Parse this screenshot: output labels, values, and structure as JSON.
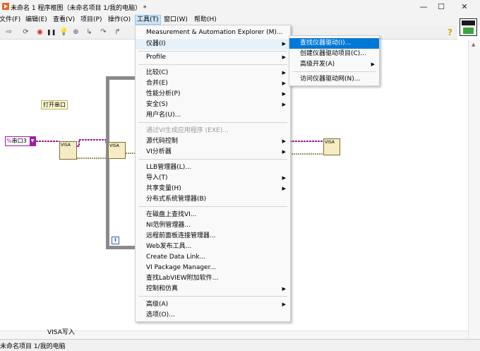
{
  "window": {
    "title": "未命名 1 程序框图（未命名项目 1/我的电脑） *",
    "min_glyph": "—",
    "max_glyph": "☐",
    "close_glyph": "✕"
  },
  "menubar": {
    "items": [
      {
        "label": "文件(F)"
      },
      {
        "label": "编辑(E)"
      },
      {
        "label": "查看(V)"
      },
      {
        "label": "项目(P)"
      },
      {
        "label": "操作(O)"
      },
      {
        "label": "工具(T)"
      },
      {
        "label": "窗口(W)"
      },
      {
        "label": "帮助(H)"
      }
    ]
  },
  "toolbar": {
    "help_glyph": "?",
    "icons": [
      {
        "name": "run-arrow-icon",
        "glyph": "⇨"
      },
      {
        "name": "run-continuous-icon",
        "glyph": "⟳"
      },
      {
        "name": "abort-icon",
        "glyph": "◉"
      },
      {
        "name": "pause-icon",
        "glyph": "❚❚"
      },
      {
        "name": "highlight-execution-icon",
        "glyph": "💡"
      },
      {
        "name": "retain-wire-values-icon",
        "glyph": "⊕"
      },
      {
        "name": "step-into-icon",
        "glyph": "↳"
      },
      {
        "name": "step-over-icon",
        "glyph": "↷"
      },
      {
        "name": "step-out-icon",
        "glyph": "↱"
      }
    ]
  },
  "diagram": {
    "label_open_port": "打开串口",
    "serial_control": "串口3",
    "serial_prefix": "%",
    "visa_caption": "VISA写入",
    "loop_iteration": "i",
    "visa_text": "VISA"
  },
  "tools_menu": {
    "items": [
      {
        "label": "Measurement & Automation Explorer (M)...",
        "submenu": false,
        "disabled": false
      },
      {
        "label": "仪器(I)",
        "submenu": true,
        "disabled": false,
        "highlighted": true
      },
      {
        "label": "Profile",
        "submenu": true,
        "disabled": false
      },
      {
        "label": "比较(C)",
        "submenu": true,
        "disabled": false
      },
      {
        "label": "合并(E)",
        "submenu": true,
        "disabled": false
      },
      {
        "label": "性能分析(P)",
        "submenu": true,
        "disabled": false
      },
      {
        "label": "安全(S)",
        "submenu": true,
        "disabled": false
      },
      {
        "label": "用户名(U)...",
        "submenu": false,
        "disabled": false
      },
      {
        "label": "通过VI生成应用程序 (EXE)...",
        "submenu": false,
        "disabled": true
      },
      {
        "label": "源代码控制",
        "submenu": true,
        "disabled": false
      },
      {
        "label": "VI分析器",
        "submenu": true,
        "disabled": false
      },
      {
        "label": "LLB管理器(L)...",
        "submenu": false,
        "disabled": false
      },
      {
        "label": "导入(T)",
        "submenu": true,
        "disabled": false
      },
      {
        "label": "共享变量(H)",
        "submenu": true,
        "disabled": false
      },
      {
        "label": "分布式系统管理器(B)",
        "submenu": false,
        "disabled": false
      },
      {
        "label": "在磁盘上查找VI...",
        "submenu": false,
        "disabled": false
      },
      {
        "label": "NI范例管理器...",
        "submenu": false,
        "disabled": false
      },
      {
        "label": "远程前面板连接管理器...",
        "submenu": false,
        "disabled": false
      },
      {
        "label": "Web发布工具...",
        "submenu": false,
        "disabled": false
      },
      {
        "label": "Create Data Link...",
        "submenu": false,
        "disabled": false
      },
      {
        "label": "VI Package Manager...",
        "submenu": false,
        "disabled": false
      },
      {
        "label": "查找LabVIEW附加软件...",
        "submenu": false,
        "disabled": false
      },
      {
        "label": "控制和仿真",
        "submenu": true,
        "disabled": false
      },
      {
        "label": "高级(A)",
        "submenu": true,
        "disabled": false
      },
      {
        "label": "选项(O)...",
        "submenu": false,
        "disabled": false
      }
    ]
  },
  "instruments_submenu": {
    "items": [
      {
        "label": "查找仪器驱动(I)...",
        "submenu": false,
        "highlighted": true
      },
      {
        "label": "创建仪器驱动项目(C)...",
        "submenu": false
      },
      {
        "label": "高级开发(A)",
        "submenu": true
      },
      {
        "label": "访问仪器驱动网(N)...",
        "submenu": false
      }
    ]
  },
  "statusbar": {
    "text": "未命名项目 1/我的电脑"
  }
}
